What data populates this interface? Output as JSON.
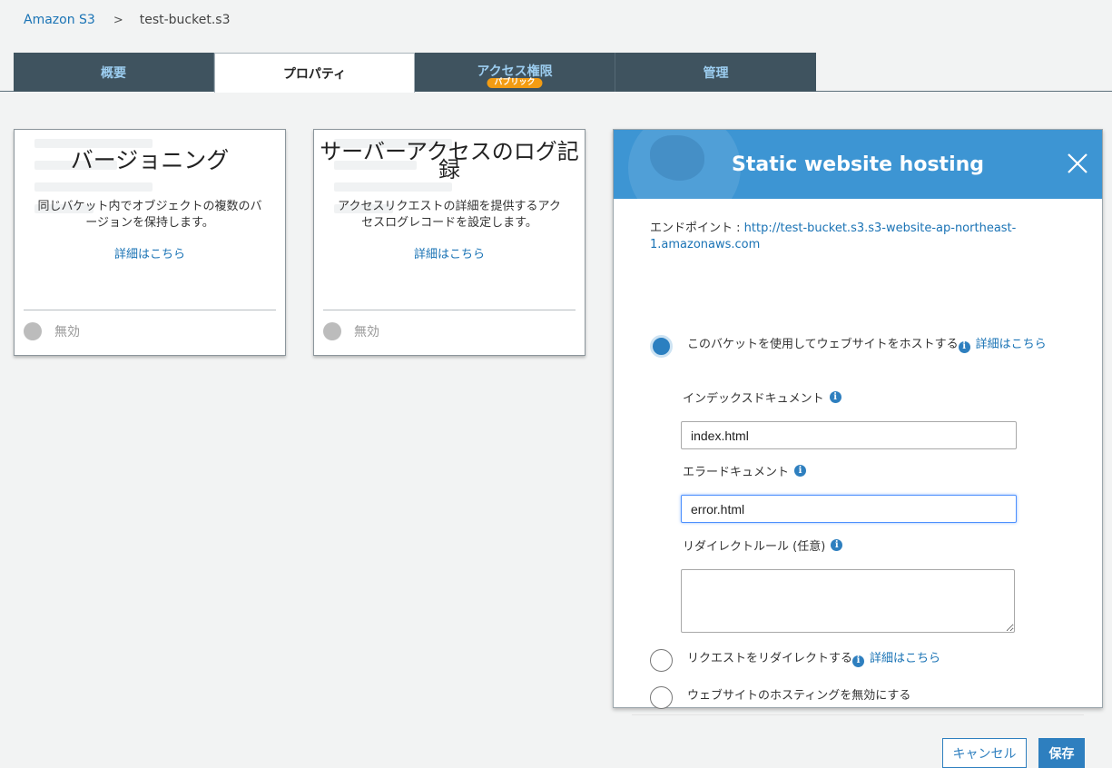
{
  "breadcrumb": {
    "root": "Amazon S3",
    "separator": ">",
    "current": "test-bucket.s3"
  },
  "tabs": [
    {
      "label": "概要",
      "active": false
    },
    {
      "label": "プロパティ",
      "active": true
    },
    {
      "label": "アクセス権限",
      "badge": "パブリック",
      "active": false
    },
    {
      "label": "管理",
      "active": false
    }
  ],
  "cards": [
    {
      "title": "バージョニング",
      "description": "同じバケット内でオブジェクトの複数のバージョンを保持します。",
      "link": "詳細はこちら",
      "status": "無効"
    },
    {
      "title": "サーバーアクセスのログ記録",
      "description": "アクセスリクエストの詳細を提供するアクセスログレコードを設定します。",
      "link": "詳細はこちら",
      "status": "無効"
    }
  ],
  "modal": {
    "title": "Static website hosting",
    "endpoint_label": "エンドポイント : ",
    "endpoint_url": "http://test-bucket.s3.s3-website-ap-northeast-1.amazonaws.com",
    "options": [
      {
        "label": "このバケットを使用してウェブサイトをホストする",
        "link": "詳細はこちら",
        "selected": true
      },
      {
        "label": "リクエストをリダイレクトする",
        "link": "詳細はこちら",
        "selected": false
      },
      {
        "label": "ウェブサイトのホスティングを無効にする",
        "selected": false
      }
    ],
    "index_document": {
      "label": "インデックスドキュメント",
      "value": "index.html"
    },
    "error_document": {
      "label": "エラードキュメント",
      "value": "error.html"
    },
    "redirect_rules": {
      "label": "リダイレクトルール (任意)",
      "value": ""
    },
    "cancel_label": "キャンセル",
    "save_label": "保存"
  },
  "colors": {
    "accent": "#2e7fbf",
    "header_blue": "#3d95d3",
    "tab_bg": "#3f535f",
    "badge": "#f39c12"
  }
}
